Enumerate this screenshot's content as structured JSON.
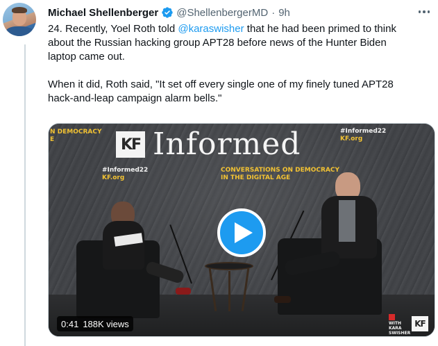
{
  "tweet": {
    "author": {
      "display_name": "Michael Shellenberger",
      "handle": "@ShellenbergerMD",
      "separator": "·",
      "time": "9h"
    },
    "text": {
      "line1_pre": "24. Recently, Yoel Roth told ",
      "mention": "@karaswisher",
      "line1_post": " that he had been primed to think",
      "line2": "about the Russian hacking group APT28 before news of the Hunter Biden",
      "line3": "laptop came out.",
      "line4": "When it did, Roth said, \"It set off every single one of my finely tuned APT28",
      "line5": "hack-and-leap campaign alarm bells.\""
    },
    "video": {
      "duration": "0:41",
      "views": "188K views",
      "stage": {
        "left_banner_line1": "N DEMOCRACY",
        "left_banner_line2": "E",
        "kf_logo": "KF",
        "title": "Informed",
        "hashtag_left": "#Informed22",
        "site_left": "KF.org",
        "subtitle_line1": "CONVERSATIONS ON DEMOCRACY",
        "subtitle_line2": "IN THE DIGITAL AGE",
        "hashtag_right": "#Informed22",
        "site_right": "KF.org"
      },
      "corner": {
        "with_line1": "WITH",
        "with_line2": "KARA",
        "with_line3": "SWISHER",
        "logo": "KF"
      }
    }
  },
  "colors": {
    "accent": "#1d9bf0",
    "text_primary": "#0f1419",
    "text_secondary": "#536471",
    "stage_yellow": "#f2c233"
  },
  "icons": {
    "verified": "verified-badge-icon",
    "more": "more-options-icon",
    "play": "play-icon"
  }
}
